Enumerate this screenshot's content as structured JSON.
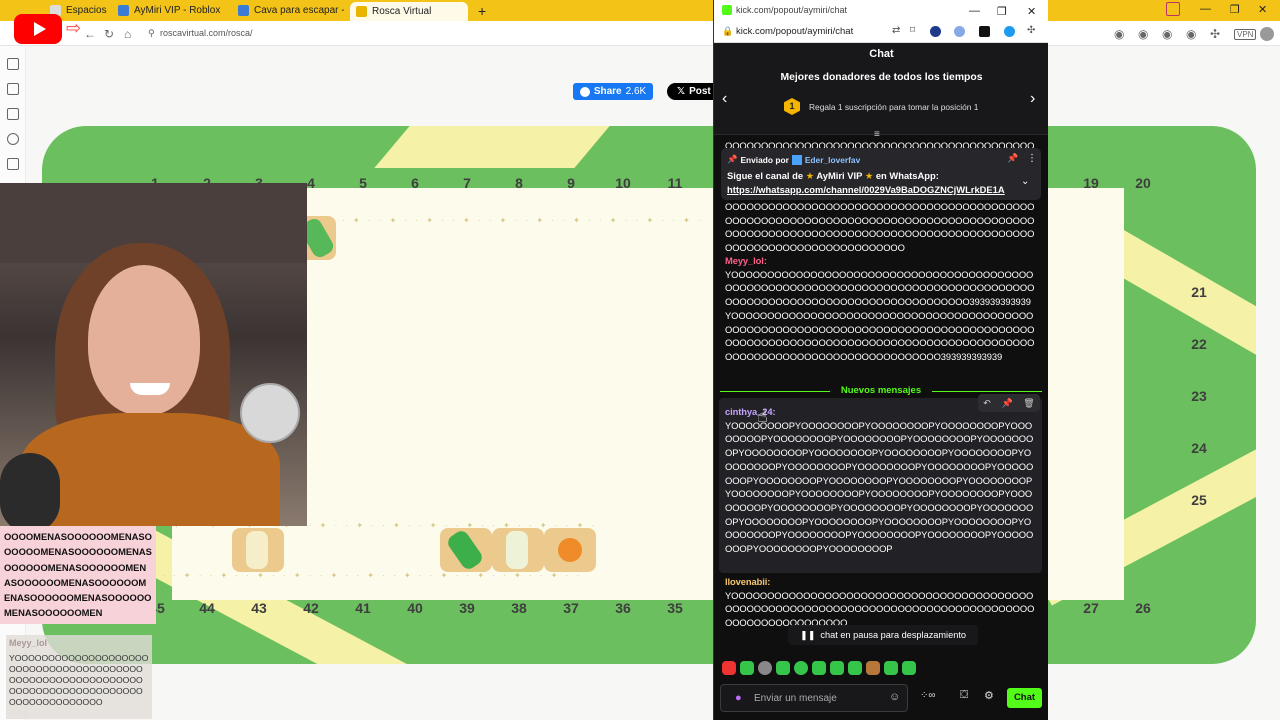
{
  "browser": {
    "tabs": [
      {
        "label": "Espacios",
        "icon": "spaces-icon"
      },
      {
        "label": "AyMiri VIP - Roblox",
        "icon": "roblox-icon"
      },
      {
        "label": "Cava para escapar - Ro...",
        "icon": "roblox-icon"
      },
      {
        "label": "Rosca Virtual",
        "icon": "rosca-icon"
      }
    ],
    "new_tab": "+",
    "address": "roscavirtual.com/rosca/",
    "accent": "#f3c318"
  },
  "share": {
    "facebook_label": "Share",
    "facebook_count": "2.6K",
    "x_label": "Post"
  },
  "board": {
    "top_numbers": [
      "1",
      "2",
      "3",
      "4",
      "5",
      "6",
      "7",
      "8",
      "9",
      "10",
      "11"
    ],
    "top_right_numbers": [
      "19",
      "20"
    ],
    "right_numbers": [
      "21",
      "22",
      "23",
      "24",
      "25"
    ],
    "bottom_numbers": [
      "45",
      "44",
      "43",
      "42",
      "41",
      "40",
      "39",
      "38",
      "37",
      "36",
      "35"
    ],
    "bottom_right_numbers": [
      "27",
      "26"
    ],
    "colors": {
      "border": "#6cbf5f",
      "inner": "#fdfbec",
      "stripe": "#f5f2a8"
    }
  },
  "overlay": {
    "donation_text": "OOOOMENASOOOOOOMENASOOOOOOMENASOOOOOOMENASOOOOOOMENASOOOOOOMENASOOOOOOMENASOOOOOOMENASOOOOOOMENASOOOOOOMENASOOOOOOMEN",
    "chat_user": "Meyy_lol",
    "chat_text": "YOOOOOOOOOOOOOOOOOOOOOOOOOOOOOOOOOOOOOOOOOOOOOOOOOOOOOOOOOOOOOOOOOOOOOOOOOOOOOOOOOOOOOOOOOOOOOO"
  },
  "popout": {
    "url": "kick.com/popout/aymiri/chat",
    "url_bar": "kick.com/popout/aymiri/chat",
    "header": "Chat",
    "donors": {
      "title": "Mejores donadores de todos los tiempos",
      "rank": "1",
      "description": "Regala 1 suscripción para tomar la posición 1"
    },
    "pinned": {
      "sent_by": "Enviado por",
      "user": "Eder_loverfav",
      "line1_a": "Sigue el canal de",
      "line1_b": "AyMiri VIP",
      "line1_c": "en WhatsApp:",
      "link": "https://whatsapp.com/channel/0029Va9BaDOGZNCjWLrkDE1A"
    },
    "messages": [
      {
        "user": "",
        "text": "OOOOOOOOOOOOOOOOOOOOOOOOOOOOOOOOOOOOOOOOOOOOOOOOOOOOOOOOOOOOOOOOOOOOOOOOOOOOOOOOOOOOOOOOOOOOOOOOOOOOOOOOOOOOOOOOOOOOOOOOOOOOOOOOOOOOOOOOOOOOOOOOOOOOOOOOOO"
      },
      {
        "user": "Meyy_lol",
        "text": "YOOOOOOOOOOOOOOOOOOOOOOOOOOOOOOOOOOOOOOOOOOOOOOOOOOOOOOOOOOOOOOOOOOOOOOOOOOOOOOOOOOOOOOOOOOOOOOOOOOOOOOOOOOOOOOOOOOOOOOO393939393939YOOOOOOOOOOOOOOOOOOOOOOOOOOOOOOOOOOOOOOOOOOOOOOOOOOOOOOOOOOOOOOOOOOOOOOOOOOOOOOOOOOOOOOOOOOOOOOOOOOOOOOOOOOOOOOOOOOOOOOOOOOOOOOOOOOOOOOOOOOOOOOOOOOOOOOOOOOOOOO393939393939"
      },
      {
        "user": "cinthya_24",
        "text": "YOOOOOOOOPYOOOOOOOOPYOOOOOOOOPYOOOOOOOOPYOOOOOOOOPYOOOOOOOOPYOOOOOOOOPYOOOOOOOOPYOOOOOOOOPYOOOOOOOOPYOOOOOOOOPYOOOOOOOOPYOOOOOOOOPYOOOOOOOOPYOOOOOOOOPYOOOOOOOOPYOOOOOOOOPYOOOOOOOOPYOOOOOOOOPYOOOOOOOOPYOOOOOOOOPYOOOOOOOOPYOOOOOOOOPYOOOOOOOOPYOOOOOOOOPYOOOOOOOOPYOOOOOOOOPYOOOOOOOOPYOOOOOOOOPYOOOOOOOOPYOOOOOOOOPYOOOOOOOOPYOOOOOOOOPYOOOOOOOOPYOOOOOOOOPYOOOOOOOOPYOOOOOOOOPYOOOOOOOOPYOOOOOOOOPYOOOOOOOOPYOOOOOOOOPYOOOOOOOOP"
      },
      {
        "user": "llovenabii",
        "text": "YOOOOOOOOOOOOOOOOOOOOOOOOOOOOOOOOOOOOOOOOOOOOOOOOOOOOOOOOOOOOOOOOOOOOOOOOOOOOOOOOOOOOOOOOOOOOOOOOOOOOOO"
      }
    ],
    "new_messages": "Nuevos mensajes",
    "pause_banner": "chat en pausa para desplazamiento",
    "input_placeholder": "Enviar un mensaje",
    "send_label": "Chat",
    "accent": "#53fc18"
  }
}
